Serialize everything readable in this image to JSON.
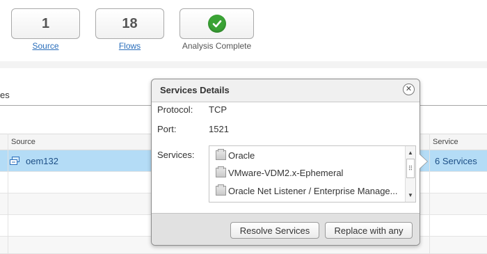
{
  "summary": {
    "source": {
      "count": "1",
      "label": "Source"
    },
    "flows": {
      "count": "18",
      "label": "Flows"
    },
    "analysis": {
      "label": "Analysis Complete",
      "icon": "checkmark-icon",
      "color": "#3aa335"
    }
  },
  "tab": {
    "partial_label": "es"
  },
  "grid": {
    "columns": {
      "source": "Source",
      "service": "Service"
    },
    "rows": [
      {
        "source": "oem132",
        "service": "6 Services",
        "selected": true
      }
    ]
  },
  "popover": {
    "title": "Services Details",
    "fields": {
      "protocol_label": "Protocol:",
      "protocol_value": "TCP",
      "port_label": "Port:",
      "port_value": "1521",
      "services_label": "Services:"
    },
    "services": [
      "Oracle",
      "VMware-VDM2.x-Ephemeral",
      "Oracle Net Listener / Enterprise Manage..."
    ],
    "buttons": {
      "resolve": "Resolve Services",
      "replace": "Replace with any"
    }
  },
  "colors": {
    "link": "#2a6ebb",
    "selected_row": "#b4dcf6",
    "success": "#3aa335"
  }
}
